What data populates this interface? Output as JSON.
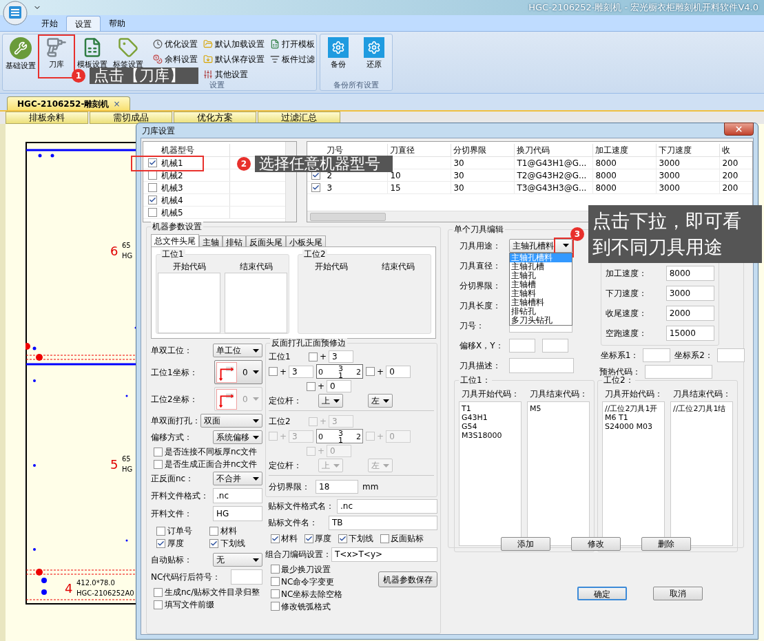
{
  "window": {
    "title": "HGC-2106252-雕刻机 - 宏光橱衣柜雕刻机开料软件V4.0"
  },
  "ribbon": {
    "tabs": [
      {
        "label": "开始",
        "selected": false
      },
      {
        "label": "设置",
        "selected": true
      },
      {
        "label": "帮助",
        "selected": false
      }
    ],
    "groups": [
      {
        "label": "设置",
        "large_buttons": [
          "基础设置",
          "刀库",
          "模板设置",
          "标签设置"
        ],
        "small_button_columns": [
          [
            "优化设置",
            "余料设置"
          ],
          [
            "默认加载设置",
            "默认保存设置",
            "其他设置"
          ],
          [
            "打开模板",
            "板件过滤"
          ]
        ]
      },
      {
        "label": "备份所有设置",
        "large_buttons": [
          "备份",
          "还原"
        ]
      }
    ]
  },
  "document_tab": {
    "label": "HGC-2106252-雕刻机",
    "close": "×"
  },
  "sheet_tabs": [
    "排板余料",
    "需切成品",
    "优化方案",
    "过滤汇总"
  ],
  "canvas": {
    "parts": [
      {
        "number": "6",
        "size": "65",
        "code": "HG"
      },
      {
        "number": "5",
        "size": "65",
        "code": "HG"
      },
      {
        "number": "4",
        "size": "412.0*78.0",
        "code": "HGC-2106252A0"
      }
    ]
  },
  "dialog": {
    "title": "刀库设置",
    "machines": {
      "column": "机器型号",
      "rows": [
        {
          "name": "机械1",
          "checked": true
        },
        {
          "name": "机械2",
          "checked": false
        },
        {
          "name": "机械3",
          "checked": false
        },
        {
          "name": "机械4",
          "checked": true
        },
        {
          "name": "机械5",
          "checked": false
        }
      ]
    },
    "tools": {
      "columns": [
        "刀号",
        "刀直径",
        "分切界限",
        "换刀代码",
        "加工速度",
        "下刀速度",
        "收"
      ],
      "rows": [
        {
          "cells": [
            "",
            "",
            "30",
            "T1@G43H1@G...",
            "8000",
            "3000",
            "200"
          ]
        },
        {
          "checked": true,
          "cells": [
            "2",
            "10",
            "30",
            "T2@G43H2@G...",
            "8000",
            "3000",
            "200"
          ]
        },
        {
          "checked": true,
          "cells": [
            "3",
            "15",
            "30",
            "T3@G43H3@G...",
            "8000",
            "3000",
            "200"
          ]
        }
      ]
    },
    "params": {
      "title": "机器参数设置",
      "tabs": [
        {
          "label": "总文件头尾",
          "selected": true
        },
        {
          "label": "主轴",
          "selected": false
        },
        {
          "label": "排钻",
          "selected": false
        },
        {
          "label": "反面头尾",
          "selected": false
        },
        {
          "label": "小板头尾",
          "selected": false
        }
      ],
      "stations": [
        {
          "title": "工位1",
          "start_label": "开始代码",
          "end_label": "结束代码",
          "enabled": true
        },
        {
          "title": "工位2",
          "start_label": "开始代码",
          "end_label": "结束代码",
          "enabled": false
        }
      ],
      "fields": [
        {
          "kind": "select",
          "label": "单双工位：",
          "value": "单工位"
        },
        {
          "kind": "corner",
          "label": "工位1坐标：",
          "value": "0",
          "disabled": false
        },
        {
          "kind": "corner",
          "label": "工位2坐标：",
          "value": "0",
          "disabled": true
        },
        {
          "kind": "select",
          "label": "单双面打孔：",
          "value": "双面"
        },
        {
          "kind": "select",
          "label": "偏移方式：",
          "value": "系统偏移"
        },
        {
          "kind": "checkbox",
          "label": "是否连接不同板厚nc文件",
          "checked": false
        },
        {
          "kind": "checkbox",
          "label": "是否生成正面合并nc文件",
          "checked": false
        },
        {
          "kind": "select",
          "label": "正反面nc：",
          "value": "不合并"
        },
        {
          "kind": "input",
          "label": "开料文件格式：",
          "value": ".nc"
        },
        {
          "kind": "input",
          "label": "开料文件：",
          "value": "HG"
        },
        {
          "kind": "checkgrid",
          "items": [
            {
              "label": "订单号",
              "checked": false
            },
            {
              "label": "材料",
              "checked": false
            },
            {
              "label": "厚度",
              "checked": true
            },
            {
              "label": "下划线",
              "checked": true
            }
          ]
        },
        {
          "kind": "select",
          "label": "自动贴标：",
          "value": "无"
        },
        {
          "kind": "input",
          "label": "NC代码行后符号："
        },
        {
          "kind": "checkbox",
          "label": "生成nc/贴标文件目录归整",
          "checked": false
        },
        {
          "kind": "checkbox",
          "label": "填写文件前缀",
          "checked": false
        }
      ],
      "trim": {
        "title": "反面打孔正面预修边",
        "stations": [
          {
            "title": "工位1",
            "disabled": false,
            "top": {
              "sign": "+",
              "value": "3",
              "checked": false
            },
            "left": {
              "sign": "+",
              "value": "3",
              "checked": false
            },
            "right": {
              "sign": "+",
              "value": "0",
              "checked": false
            },
            "bottom": {
              "sign": "+",
              "value": "0",
              "checked": false
            },
            "grid": [
              "0",
              "3",
              "1",
              "2"
            ],
            "positioner_label": "定位杆：",
            "positioners": [
              "上",
              "左"
            ]
          },
          {
            "title": "工位2",
            "disabled": true,
            "top": {
              "sign": "+",
              "value": "3",
              "checked": false
            },
            "left": {
              "sign": "+",
              "value": "3",
              "checked": false
            },
            "right": {
              "sign": "+",
              "value": "0",
              "checked": false
            },
            "bottom": {
              "sign": "+",
              "value": "0",
              "checked": false
            },
            "grid": [
              "0",
              "3",
              "1",
              "2"
            ],
            "positioner_label": "定位杆：",
            "positioners": [
              "上",
              "左"
            ]
          }
        ],
        "cut_label": "分切界限：",
        "cut_value": "18",
        "cut_unit": "mm"
      },
      "label_format": {
        "label": "贴标文件格式名：",
        "value": ".nc"
      },
      "label_file": {
        "label": "贴标文件名：",
        "value": "TB"
      },
      "label_checks": [
        {
          "label": "材料",
          "checked": true
        },
        {
          "label": "厚度",
          "checked": true
        },
        {
          "label": "下划线",
          "checked": true
        },
        {
          "label": "反面贴标",
          "checked": false
        }
      ],
      "combo_code": {
        "label": "组合刀编码设置：",
        "value": "T<x>T<y>"
      },
      "options": [
        {
          "label": "最少换刀设置",
          "checked": false
        },
        {
          "label": "NC命令字变更",
          "checked": false
        },
        {
          "label": "NC坐标去除空格",
          "checked": false
        },
        {
          "label": "修改铣弧格式",
          "checked": false
        }
      ],
      "save_button": "机器参数保存"
    },
    "tool_edit": {
      "title": "单个刀具编辑",
      "fields": [
        {
          "kind": "select",
          "label": "刀具用途：",
          "value": "主轴孔槽料",
          "open": true,
          "options": [
            {
              "label": "主轴孔槽料",
              "selected": true
            },
            {
              "label": "主轴孔槽",
              "selected": false
            },
            {
              "label": "主轴孔",
              "selected": false
            },
            {
              "label": "主轴槽",
              "selected": false
            },
            {
              "label": "主轴料",
              "selected": false
            },
            {
              "label": "主轴槽料",
              "selected": false
            },
            {
              "label": "排钻孔",
              "selected": false
            },
            {
              "label": "多刀头钻孔",
              "selected": false
            }
          ]
        },
        {
          "kind": "input",
          "label": "刀具直径："
        },
        {
          "kind": "input",
          "label": "分切界限："
        },
        {
          "kind": "input",
          "label": "刀具长度："
        },
        {
          "kind": "input",
          "label": "刀号："
        },
        {
          "kind": "pair",
          "label": "偏移X，Y："
        },
        {
          "kind": "wide",
          "label": "刀具描述："
        }
      ],
      "speeds": [
        {
          "label": "加工速度：",
          "value": "8000"
        },
        {
          "label": "下刀速度：",
          "value": "3000"
        },
        {
          "label": "收尾速度：",
          "value": "2000"
        },
        {
          "label": "空跑速度：",
          "value": "15000"
        }
      ],
      "coords": [
        {
          "label": "坐标系1："
        },
        {
          "label": "坐标系2："
        }
      ],
      "preheat": {
        "label": "预热代码："
      },
      "stations": [
        {
          "title": "工位1：",
          "start_label": "刀具开始代码：",
          "end_label": "刀具结束代码：",
          "start": [
            "T1",
            "G43H1",
            "G54",
            "M3S18000"
          ],
          "end": [
            "M5"
          ]
        },
        {
          "title": "工位2：",
          "start_label": "刀具开始代码：",
          "end_label": "刀具结束代码：",
          "start": [
            "//工位2刀具1开",
            "M6 T1",
            "S24000 M03"
          ],
          "end": [
            "//工位2刀具1结"
          ]
        }
      ],
      "buttons": [
        "添加",
        "修改",
        "删除"
      ]
    },
    "buttons": [
      {
        "label": "确定",
        "default": true
      },
      {
        "label": "取消",
        "default": false
      }
    ]
  },
  "callouts": [
    {
      "number": "1",
      "text": "点击【刀库】"
    },
    {
      "number": "2",
      "text": "选择任意机器型号"
    },
    {
      "number": "3",
      "text": "点击下拉，即可看到不同刀具用途"
    }
  ]
}
